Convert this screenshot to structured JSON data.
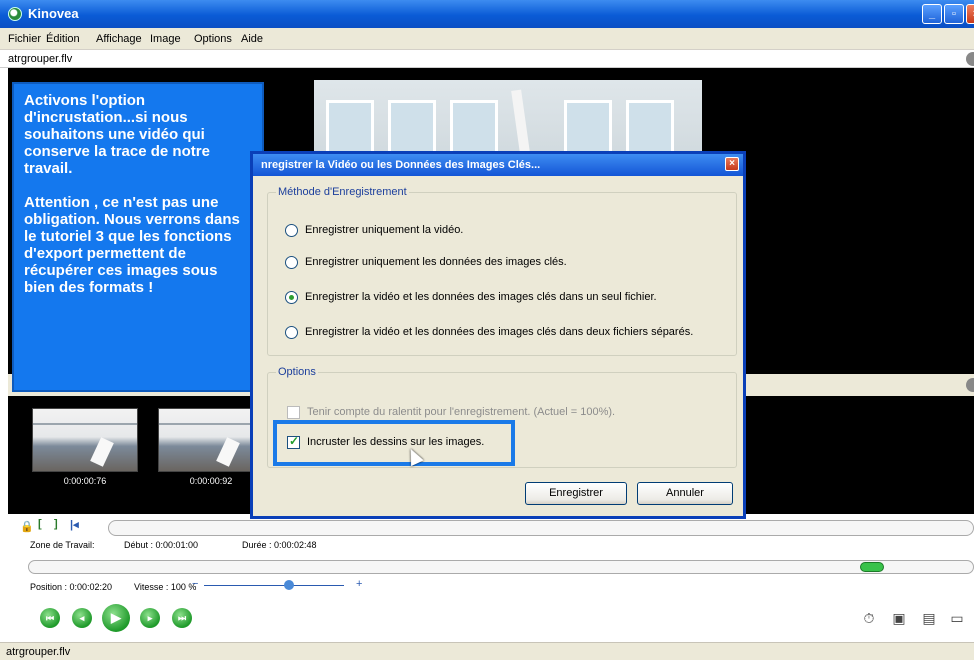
{
  "app": {
    "title": "Kinovea"
  },
  "menu": [
    "Fichier",
    "Édition",
    "Affichage",
    "Image",
    "Options",
    "Aide"
  ],
  "file_tab": "atrgrouper.flv",
  "callout": {
    "para1": "Activons l'option d'incrustation...si nous souhaitons une vidéo qui conserve la trace de notre travail.",
    "para2": "Attention , ce n'est pas une obligation. Nous verrons dans le tutoriel 3 que les fonctions d'export permettent de récupérer ces images sous bien des formats !"
  },
  "dialog": {
    "title": "nregistrer la Vidéo ou les Données des Images Clés...",
    "method_group": "Méthode d'Enregistrement",
    "radios": [
      {
        "label": "Enregistrer uniquement la vidéo.",
        "selected": false
      },
      {
        "label": "Enregistrer uniquement les données des images clés.",
        "selected": false
      },
      {
        "label": "Enregistrer la vidéo et les données des images clés dans un seul fichier.",
        "selected": true
      },
      {
        "label": "Enregistrer la vidéo et les données des images clés dans deux fichiers séparés.",
        "selected": false
      }
    ],
    "options_group": "Options",
    "opt_slowmo": {
      "label": "Tenir compte du ralentit pour l'enregistrement. (Actuel = 100%).",
      "checked": false
    },
    "opt_overlay": {
      "label": "Incruster les dessins sur les images.",
      "checked": true
    },
    "save_button": "Enregistrer",
    "cancel_button": "Annuler"
  },
  "thumbnails": [
    {
      "time": "0:00:00:76"
    },
    {
      "time": "0:00:00:92"
    }
  ],
  "controls": {
    "zone_label": "Zone de Travail:",
    "debut": "Début : 0:00:01:00",
    "duree": "Durée : 0:00:02:48",
    "position": "Position : 0:00:02:20",
    "vitesse": "Vitesse : 100 %"
  },
  "status": "atrgrouper.flv",
  "colors": {
    "callout": "#1478ee",
    "highlight": "#1a7ae8",
    "titlebar": "#0a5bd6"
  }
}
